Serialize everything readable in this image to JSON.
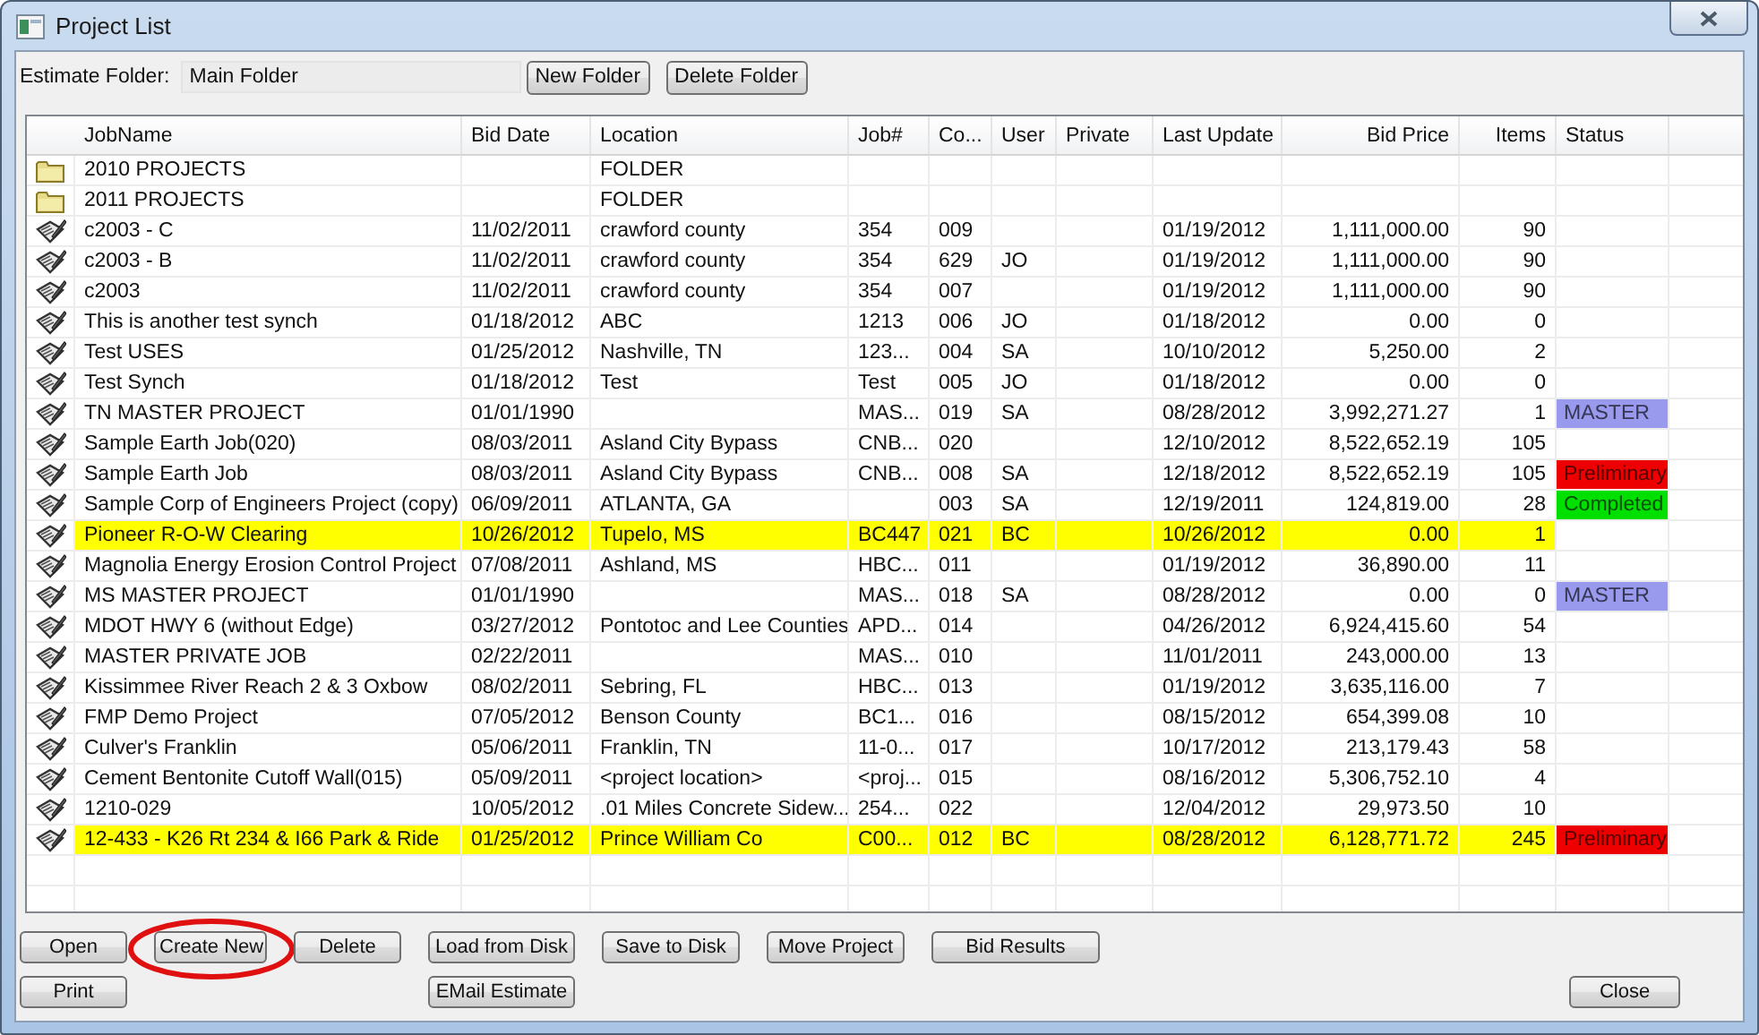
{
  "window": {
    "title": "Project List"
  },
  "folder": {
    "label": "Estimate Folder:",
    "value": "Main Folder",
    "buttons": [
      "New Folder",
      "Delete Folder"
    ]
  },
  "table": {
    "columns": [
      "JobName",
      "Bid Date",
      "Location",
      "Job#",
      "Co...",
      "User",
      "Private",
      "Last Update",
      "Bid Price",
      "Items",
      "Status"
    ],
    "rows": [
      {
        "kind": "folder",
        "highlighted": false,
        "name": "2010 PROJECTS",
        "location": "FOLDER"
      },
      {
        "kind": "folder",
        "highlighted": false,
        "name": "2011 PROJECTS",
        "location": "FOLDER"
      },
      {
        "kind": "project",
        "highlighted": false,
        "name": "c2003 - C",
        "bid_date": "11/02/2011",
        "location": "crawford county",
        "job_no": "354",
        "co": "009",
        "last_update": "01/19/2012",
        "bid_price": "1,111,000.00",
        "items": "90"
      },
      {
        "kind": "project",
        "highlighted": false,
        "name": "c2003 - B",
        "bid_date": "11/02/2011",
        "location": "crawford county",
        "job_no": "354",
        "co": "629",
        "user": "JO",
        "last_update": "01/19/2012",
        "bid_price": "1,111,000.00",
        "items": "90"
      },
      {
        "kind": "project",
        "highlighted": false,
        "name": "c2003",
        "bid_date": "11/02/2011",
        "location": "crawford county",
        "job_no": "354",
        "co": "007",
        "last_update": "01/19/2012",
        "bid_price": "1,111,000.00",
        "items": "90"
      },
      {
        "kind": "project",
        "highlighted": false,
        "name": "This is another test synch",
        "bid_date": "01/18/2012",
        "location": "ABC",
        "job_no": "1213",
        "co": "006",
        "user": "JO",
        "last_update": "01/18/2012",
        "bid_price": "0.00",
        "items": "0"
      },
      {
        "kind": "project",
        "highlighted": false,
        "name": "Test USES",
        "bid_date": "01/25/2012",
        "location": "Nashville, TN",
        "job_no": "123...",
        "co": "004",
        "user": "SA",
        "last_update": "10/10/2012",
        "bid_price": "5,250.00",
        "items": "2"
      },
      {
        "kind": "project",
        "highlighted": false,
        "name": "Test Synch",
        "bid_date": "01/18/2012",
        "location": "Test",
        "job_no": "Test",
        "co": "005",
        "user": "JO",
        "last_update": "01/18/2012",
        "bid_price": "0.00",
        "items": "0"
      },
      {
        "kind": "project",
        "highlighted": false,
        "name": "TN MASTER PROJECT",
        "bid_date": "01/01/1990",
        "job_no": "MAS...",
        "co": "019",
        "user": "SA",
        "last_update": "08/28/2012",
        "bid_price": "3,992,271.27",
        "items": "1",
        "status": {
          "text": "MASTER",
          "color": "#9999ee"
        }
      },
      {
        "kind": "project",
        "highlighted": false,
        "name": "Sample Earth Job(020)",
        "bid_date": "08/03/2011",
        "location": "Asland City Bypass",
        "job_no": "CNB...",
        "co": "020",
        "last_update": "12/10/2012",
        "bid_price": "8,522,652.19",
        "items": "105"
      },
      {
        "kind": "project",
        "highlighted": false,
        "name": "Sample Earth Job",
        "bid_date": "08/03/2011",
        "location": "Asland City Bypass",
        "job_no": "CNB...",
        "co": "008",
        "user": "SA",
        "last_update": "12/18/2012",
        "bid_price": "8,522,652.19",
        "items": "105",
        "status": {
          "text": "Preliminary",
          "color": "#ee0000"
        }
      },
      {
        "kind": "project",
        "highlighted": false,
        "name": "Sample Corp of Engineers Project (copy)",
        "bid_date": "06/09/2011",
        "location": "ATLANTA, GA",
        "co": "003",
        "user": "SA",
        "last_update": "12/19/2011",
        "bid_price": "124,819.00",
        "items": "28",
        "status": {
          "text": "Completed",
          "color": "#00e000"
        }
      },
      {
        "kind": "project",
        "highlighted": true,
        "name": "Pioneer R-O-W Clearing",
        "bid_date": "10/26/2012",
        "location": "Tupelo, MS",
        "job_no": "BC447",
        "co": "021",
        "user": "BC",
        "last_update": "10/26/2012",
        "bid_price": "0.00",
        "items": "1"
      },
      {
        "kind": "project",
        "highlighted": false,
        "name": "Magnolia Energy Erosion Control Project",
        "bid_date": "07/08/2011",
        "location": "Ashland, MS",
        "job_no": "HBC...",
        "co": "011",
        "last_update": "01/19/2012",
        "bid_price": "36,890.00",
        "items": "11"
      },
      {
        "kind": "project",
        "highlighted": false,
        "name": "MS MASTER PROJECT",
        "bid_date": "01/01/1990",
        "job_no": "MAS...",
        "co": "018",
        "user": "SA",
        "last_update": "08/28/2012",
        "bid_price": "0.00",
        "items": "0",
        "status": {
          "text": "MASTER",
          "color": "#9999ee"
        }
      },
      {
        "kind": "project",
        "highlighted": false,
        "name": "MDOT HWY 6 (without Edge)",
        "bid_date": "03/27/2012",
        "location": "Pontotoc and Lee Counties",
        "job_no": "APD...",
        "co": "014",
        "last_update": "04/26/2012",
        "bid_price": "6,924,415.60",
        "items": "54"
      },
      {
        "kind": "project",
        "highlighted": false,
        "name": "MASTER PRIVATE JOB",
        "bid_date": "02/22/2011",
        "job_no": "MAS...",
        "co": "010",
        "last_update": "11/01/2011",
        "bid_price": "243,000.00",
        "items": "13"
      },
      {
        "kind": "project",
        "highlighted": false,
        "name": "Kissimmee River Reach 2 & 3 Oxbow",
        "bid_date": "08/02/2011",
        "location": "Sebring, FL",
        "job_no": "HBC...",
        "co": "013",
        "last_update": "01/19/2012",
        "bid_price": "3,635,116.00",
        "items": "7"
      },
      {
        "kind": "project",
        "highlighted": false,
        "name": "FMP Demo Project",
        "bid_date": "07/05/2012",
        "location": "Benson County",
        "job_no": "BC1...",
        "co": "016",
        "last_update": "08/15/2012",
        "bid_price": "654,399.08",
        "items": "10"
      },
      {
        "kind": "project",
        "highlighted": false,
        "name": "Culver's Franklin",
        "bid_date": "05/06/2011",
        "location": "Franklin, TN",
        "job_no": "11-0...",
        "co": "017",
        "last_update": "10/17/2012",
        "bid_price": "213,179.43",
        "items": "58"
      },
      {
        "kind": "project",
        "highlighted": false,
        "name": "Cement Bentonite Cutoff Wall(015)",
        "bid_date": "05/09/2011",
        "location": "<project location>",
        "job_no": "<proj...",
        "co": "015",
        "last_update": "08/16/2012",
        "bid_price": "5,306,752.10",
        "items": "4"
      },
      {
        "kind": "project",
        "highlighted": false,
        "name": "1210-029",
        "bid_date": "10/05/2012",
        "location": ".01 Miles Concrete Sidew...",
        "job_no": "254...",
        "co": "022",
        "last_update": "12/04/2012",
        "bid_price": "29,973.50",
        "items": "10"
      },
      {
        "kind": "project",
        "highlighted": true,
        "name": "12-433 - K26 Rt 234 & I66 Park & Ride",
        "bid_date": "01/25/2012",
        "location": "Prince William Co",
        "job_no": "C00...",
        "co": "012",
        "user": "BC",
        "last_update": "08/28/2012",
        "bid_price": "6,128,771.72",
        "items": "245",
        "status": {
          "text": "Preliminary",
          "color": "#ee0000"
        }
      }
    ]
  },
  "buttons": [
    {
      "label": "Open",
      "circled": false
    },
    {
      "label": "Create New",
      "circled": true
    },
    {
      "label": "Delete",
      "circled": false
    },
    {
      "label": "Load from Disk",
      "circled": false
    },
    {
      "label": "Save to Disk",
      "circled": false
    },
    {
      "label": "Move Project",
      "circled": false
    },
    {
      "label": "Bid Results",
      "circled": false
    },
    {
      "label": "Print",
      "circled": false
    },
    {
      "label": "EMail Estimate",
      "circled": false
    },
    {
      "label": "Close",
      "circled": false
    }
  ]
}
